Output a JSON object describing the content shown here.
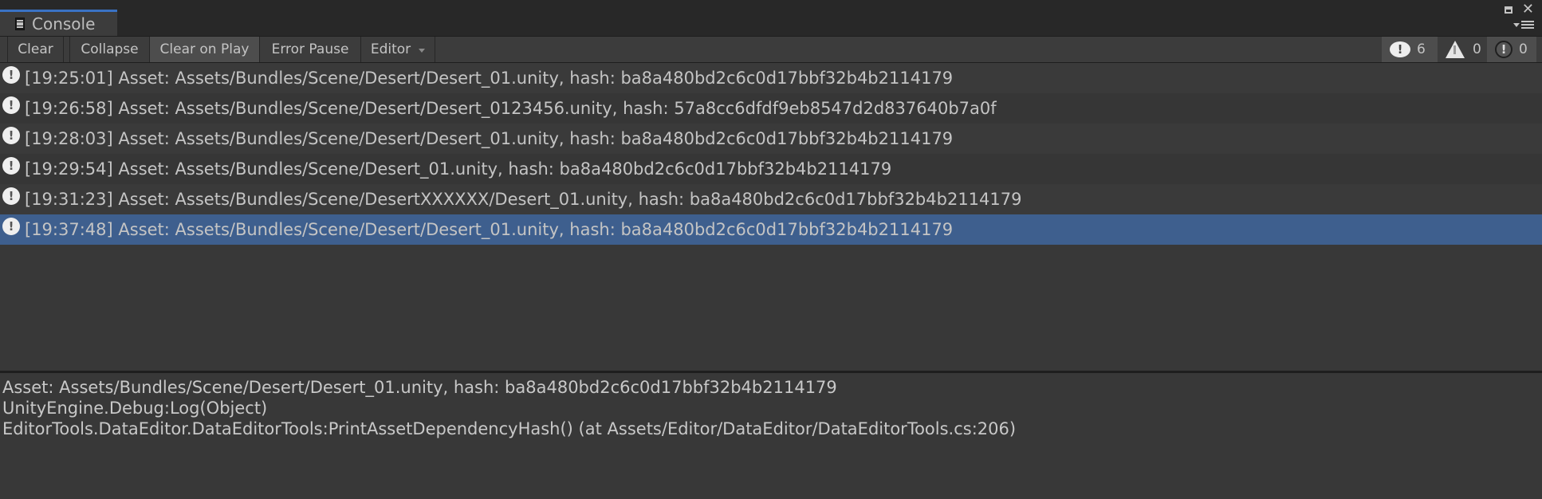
{
  "window": {
    "tab_label": "Console",
    "tab_icon": "console-icon",
    "controls": [
      "maximize-icon",
      "close-icon",
      "window-menu-icon"
    ]
  },
  "toolbar": {
    "clear": "Clear",
    "collapse": "Collapse",
    "clear_on_play": "Clear on Play",
    "error_pause": "Error Pause",
    "editor": "Editor",
    "log_count": "6",
    "warning_count": "0",
    "error_count": "0"
  },
  "colors": {
    "selection": "#3e5f8e",
    "tab_accent": "#3a72c4"
  },
  "logs": [
    {
      "time": "[19:25:01]",
      "message": "Asset: Assets/Bundles/Scene/Desert/Desert_01.unity, hash: ba8a480bd2c6c0d17bbf32b4b2114179",
      "icon": "info-icon"
    },
    {
      "time": "[19:26:58]",
      "message": "Asset: Assets/Bundles/Scene/Desert/Desert_0123456.unity, hash: 57a8cc6dfdf9eb8547d2d837640b7a0f",
      "icon": "info-icon"
    },
    {
      "time": "[19:28:03]",
      "message": "Asset: Assets/Bundles/Scene/Desert/Desert_01.unity, hash: ba8a480bd2c6c0d17bbf32b4b2114179",
      "icon": "info-icon"
    },
    {
      "time": "[19:29:54]",
      "message": "Asset: Assets/Bundles/Scene/Desert_01.unity, hash: ba8a480bd2c6c0d17bbf32b4b2114179",
      "icon": "info-icon"
    },
    {
      "time": "[19:31:23]",
      "message": "Asset: Assets/Bundles/Scene/DesertXXXXXX/Desert_01.unity, hash: ba8a480bd2c6c0d17bbf32b4b2114179",
      "icon": "info-icon"
    },
    {
      "time": "[19:37:48]",
      "message": "Asset: Assets/Bundles/Scene/Desert/Desert_01.unity, hash: ba8a480bd2c6c0d17bbf32b4b2114179",
      "icon": "info-icon",
      "selected": true
    }
  ],
  "detail": {
    "lines": [
      "Asset: Assets/Bundles/Scene/Desert/Desert_01.unity, hash: ba8a480bd2c6c0d17bbf32b4b2114179",
      "UnityEngine.Debug:Log(Object)",
      "EditorTools.DataEditor.DataEditorTools:PrintAssetDependencyHash() (at Assets/Editor/DataEditor/DataEditorTools.cs:206)"
    ]
  }
}
